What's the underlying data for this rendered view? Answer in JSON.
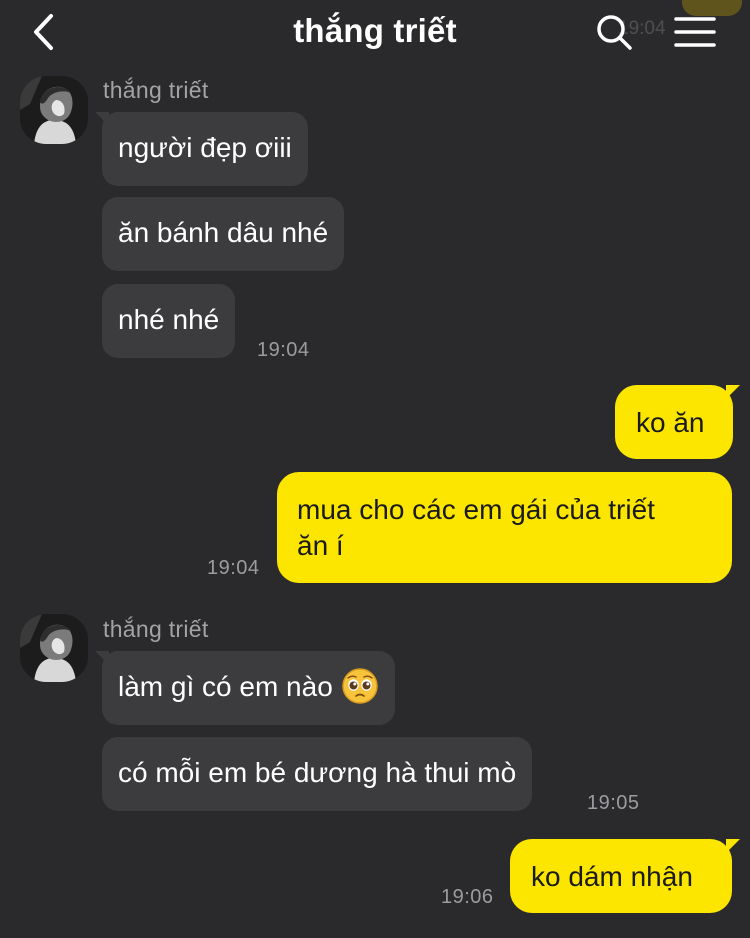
{
  "header": {
    "title": "thắng triết",
    "ghost_time": "19:04"
  },
  "messages": [
    {
      "group": 1,
      "sender": "thắng triết",
      "bubbles": [
        "người đẹp ơiii",
        "ăn bánh dâu nhé",
        "nhé nhé"
      ],
      "time": "19:04"
    },
    {
      "group": 2,
      "outgoing": true,
      "bubbles": [
        "ko ăn",
        "mua cho các em gái của triết",
        "ăn í"
      ],
      "time": "19:04"
    },
    {
      "group": 3,
      "sender": "thắng triết",
      "bubbles": [
        "làm gì có em nào",
        "có mỗi em bé dương hà thui mò"
      ],
      "emoji": "pleading-face-emoji",
      "time": "19:05"
    },
    {
      "group": 4,
      "outgoing": true,
      "bubbles": [
        "ko dám nhận"
      ],
      "time": "19:06"
    }
  ],
  "colors": {
    "background": "#2a2a2c",
    "incoming_bubble": "#3c3c3f",
    "outgoing_bubble": "#fce600",
    "time_text": "#9c9ca0"
  },
  "icons": {
    "back": "chevron-left-icon",
    "search": "search-icon",
    "menu": "hamburger-menu-icon"
  }
}
